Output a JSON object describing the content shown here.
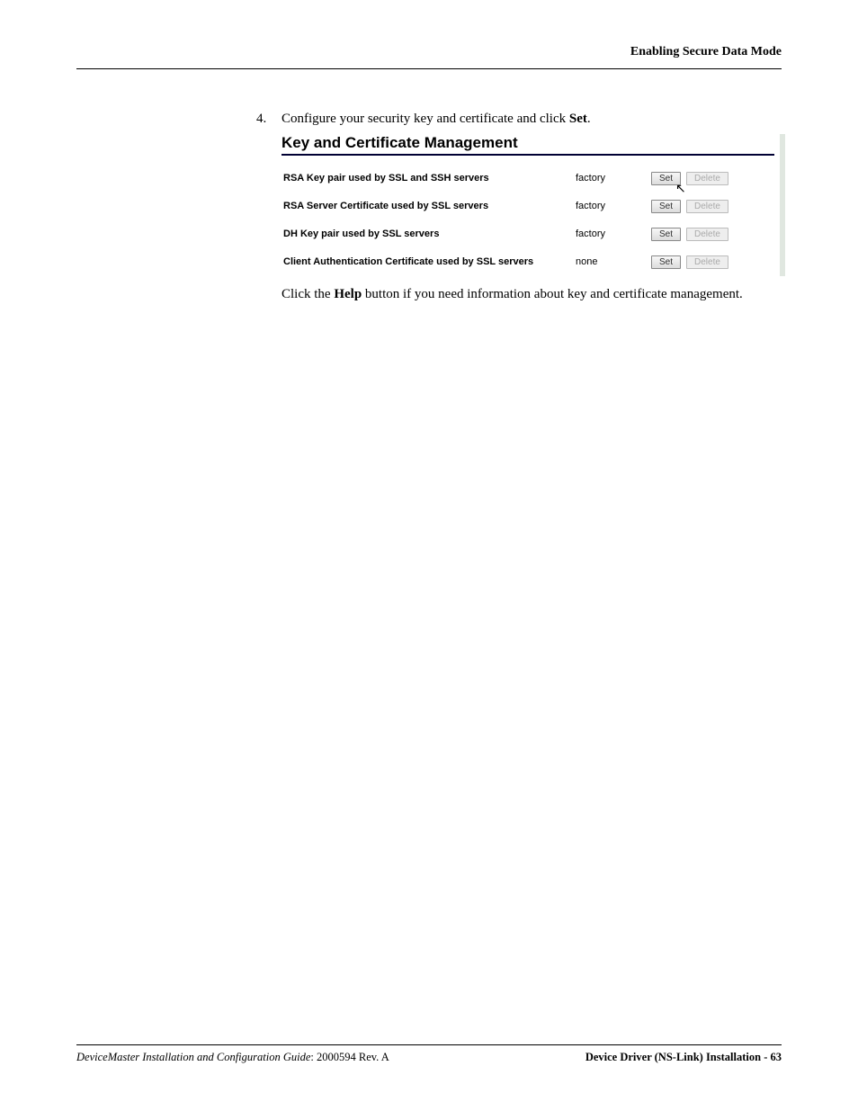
{
  "header": {
    "right_title": "Enabling Secure Data Mode"
  },
  "step": {
    "number": "4.",
    "text_pre": "Configure your security key and certificate and click ",
    "bold_word": "Set",
    "text_post": "."
  },
  "panel": {
    "title": "Key and Certificate Management",
    "rows": [
      {
        "label": "RSA Key pair used by SSL and SSH servers",
        "value": "factory",
        "set": "Set",
        "del": "Delete",
        "del_disabled": true,
        "cursor": true
      },
      {
        "label": "RSA Server Certificate used by SSL servers",
        "value": "factory",
        "set": "Set",
        "del": "Delete",
        "del_disabled": true,
        "cursor": false
      },
      {
        "label": "DH Key pair used by SSL servers",
        "value": "factory",
        "set": "Set",
        "del": "Delete",
        "del_disabled": true,
        "cursor": false
      },
      {
        "label": "Client Authentication Certificate used by SSL servers",
        "value": "none",
        "set": "Set",
        "del": "Delete",
        "del_disabled": true,
        "cursor": false
      }
    ]
  },
  "after": {
    "pre": "Click the ",
    "bold": "Help",
    "post": " button if you need information about key and certificate management."
  },
  "footer": {
    "left_italic": "DeviceMaster Installation and Configuration Guide",
    "left_rev": ": 2000594 Rev. A",
    "right": "Device Driver (NS-Link) Installation  - 63"
  }
}
